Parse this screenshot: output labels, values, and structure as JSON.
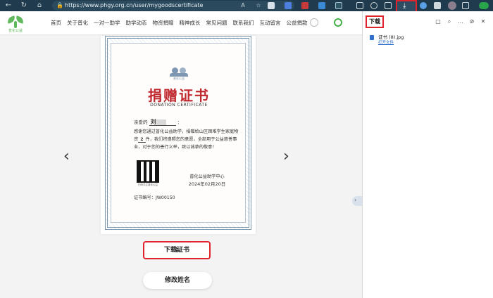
{
  "browser": {
    "url": "https://www.phgy.org.cn/user/mygoodscertificate"
  },
  "site": {
    "logo_text": "普化公益",
    "menu": [
      "首页",
      "关于普化",
      "一对一助学",
      "助学动态",
      "物资捐赠",
      "精神成长",
      "常见问题",
      "联系我们",
      "互动留言",
      "公益捐款"
    ]
  },
  "certificate": {
    "title": "捐赠证书",
    "subtitle": "DONATION CERTIFICATE",
    "greeting_prefix": "亲爱的",
    "name": "刘",
    "greeting_suffix": "：",
    "body_1": "感谢您通过普化公益助学，捐赠给山区困难学生家庭物资",
    "quantity": "2",
    "body_2": "件，我们将遵照您的意愿，全部用于公益慈善事业，对于您的善行义举，致以诚挚的敬意！",
    "qr_caption": "扫码关注普化公益",
    "org": "普化公益助学中心",
    "date": "2024年02月20日",
    "number_label": "证书编号：",
    "number": "JW00150"
  },
  "actions": {
    "download": "下载证书",
    "rename": "修改姓名"
  },
  "download_panel": {
    "title": "下载",
    "file_name": "证书 (8).jpg",
    "open_label": "打开文件"
  },
  "colors": {
    "accent_red": "#e0242b",
    "cert_title": "#c0282f",
    "browser_bar": "#1f3b4d",
    "brand_green": "#5fb85b"
  }
}
